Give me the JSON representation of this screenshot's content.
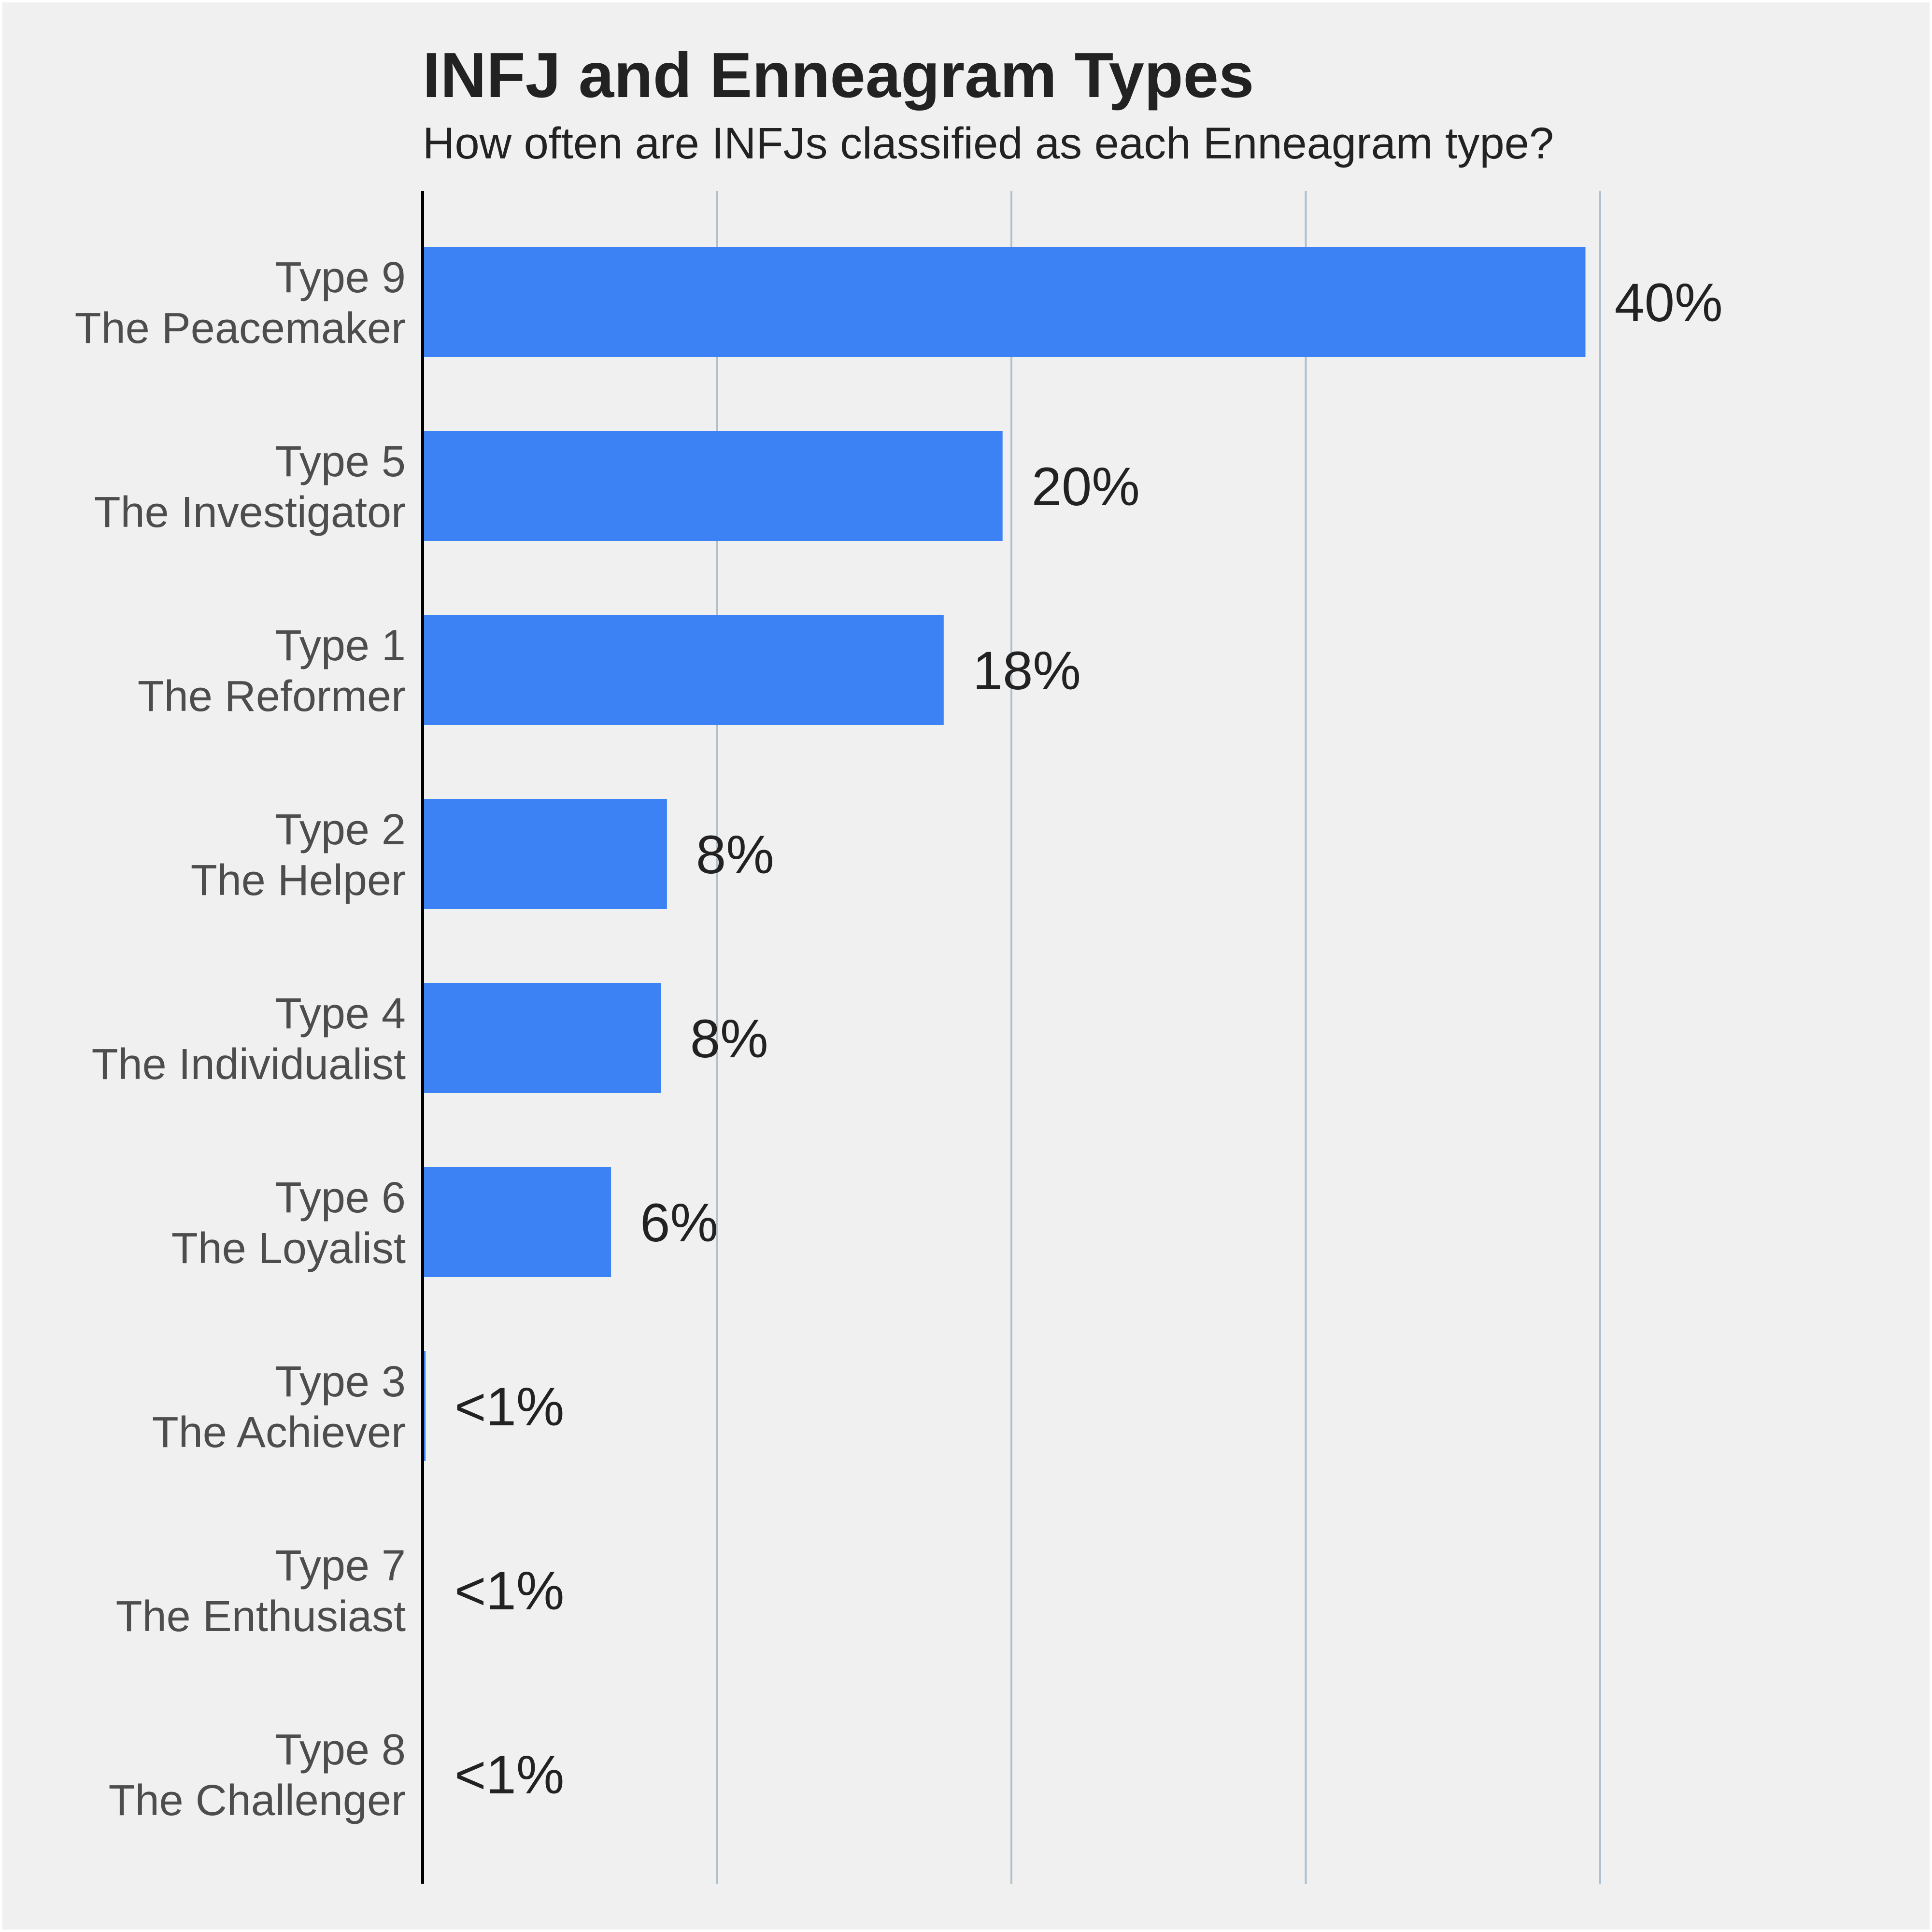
{
  "chart_data": {
    "type": "bar",
    "orientation": "horizontal",
    "title": "INFJ and Enneagram Types",
    "subtitle": "How often are INFJs classified as each Enneagram type?",
    "xlabel": "",
    "ylabel": "",
    "xlim": [
      0,
      50
    ],
    "grid": true,
    "gridlines_at": [
      10,
      20,
      30,
      40
    ],
    "categories": [
      {
        "type": "Type 9",
        "name": "The Peacemaker"
      },
      {
        "type": "Type 5",
        "name": "The Investigator"
      },
      {
        "type": "Type 1",
        "name": "The Reformer"
      },
      {
        "type": "Type 2",
        "name": "The Helper"
      },
      {
        "type": "Type 4",
        "name": "The Individualist"
      },
      {
        "type": "Type 6",
        "name": "The Loyalist"
      },
      {
        "type": "Type 3",
        "name": "The Achiever"
      },
      {
        "type": "Type 7",
        "name": "The Enthusiast"
      },
      {
        "type": "Type 8",
        "name": "The Challenger"
      }
    ],
    "values": [
      39.5,
      19.7,
      17.7,
      8.3,
      8.1,
      6.4,
      0.1,
      0,
      0
    ],
    "value_labels": [
      "40%",
      "20%",
      "18%",
      "8%",
      "8%",
      "6%",
      "<1%",
      "<1%",
      "<1%"
    ],
    "bar_color": "#3d82f4",
    "legend": "none"
  }
}
